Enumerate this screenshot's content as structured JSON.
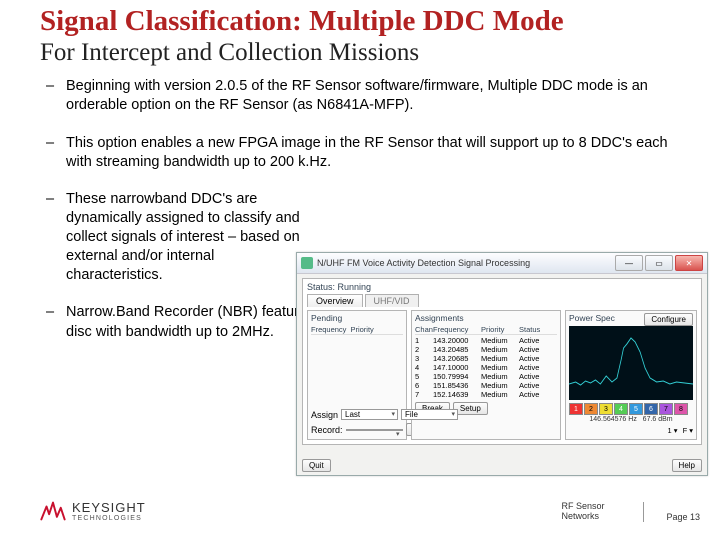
{
  "title": "Signal Classification: Multiple DDC Mode",
  "subtitle": "For Intercept and Collection Missions",
  "bullets": [
    "Beginning with version 2.0.5 of the RF Sensor software/firmware, Multiple DDC mode is an orderable option on the RF Sensor (as N6841A-MFP).",
    "This option enables a new FPGA image in the RF Sensor that will support up to 8 DDC's each with streaming bandwidth up to 200 k.Hz.",
    "These narrowband DDC's are dynamically assigned to classify and collect signals of interest – based on external and/or internal characteristics.",
    "Narrow.Band Recorder (NBR) feature can stream single channel of IQ data to disc with bandwidth up to 2MHz."
  ],
  "window": {
    "title": "N/UHF FM Voice Activity Detection Signal Processing",
    "section": "Status: Running",
    "tabs": [
      "Overview",
      "UHF/VID"
    ],
    "panes": {
      "pending": {
        "title": "Pending",
        "cols": [
          "Frequency",
          "Priority"
        ]
      },
      "assignments": {
        "title": "Assignments",
        "cols": [
          "Chan",
          "Frequency",
          "Priority",
          "Status"
        ],
        "rows": [
          [
            "1",
            "143.20000",
            "Medium",
            "Active"
          ],
          [
            "2",
            "143.20485",
            "Medium",
            "Active"
          ],
          [
            "3",
            "143.20685",
            "Medium",
            "Active"
          ],
          [
            "4",
            "147.10000",
            "Medium",
            "Active"
          ],
          [
            "5",
            "150.79994",
            "Medium",
            "Active"
          ],
          [
            "6",
            "151.85436",
            "Medium",
            "Active"
          ],
          [
            "7",
            "152.14639",
            "Medium",
            "Active"
          ]
        ],
        "buttons": [
          "Break",
          "Setup"
        ],
        "control_labels": [
          "Assign",
          "Last",
          "File"
        ],
        "record_label": "Record:",
        "record_button": "Setup"
      },
      "spectrum": {
        "title": "Power Spec",
        "configure": "Configure",
        "cursor_boxes": [
          "1",
          "2",
          "3",
          "4",
          "5",
          "6",
          "7",
          "8"
        ],
        "xaxis_left": "146.564576 Hz",
        "xaxis_right": "67.6 dBm"
      }
    },
    "footer_buttons": [
      "Quit",
      "Help"
    ]
  },
  "brand": {
    "name": "KEYSIGHT",
    "sub": "TECHNOLOGIES"
  },
  "footer": {
    "group": "RF Sensor Networks",
    "page": "Page 13"
  }
}
